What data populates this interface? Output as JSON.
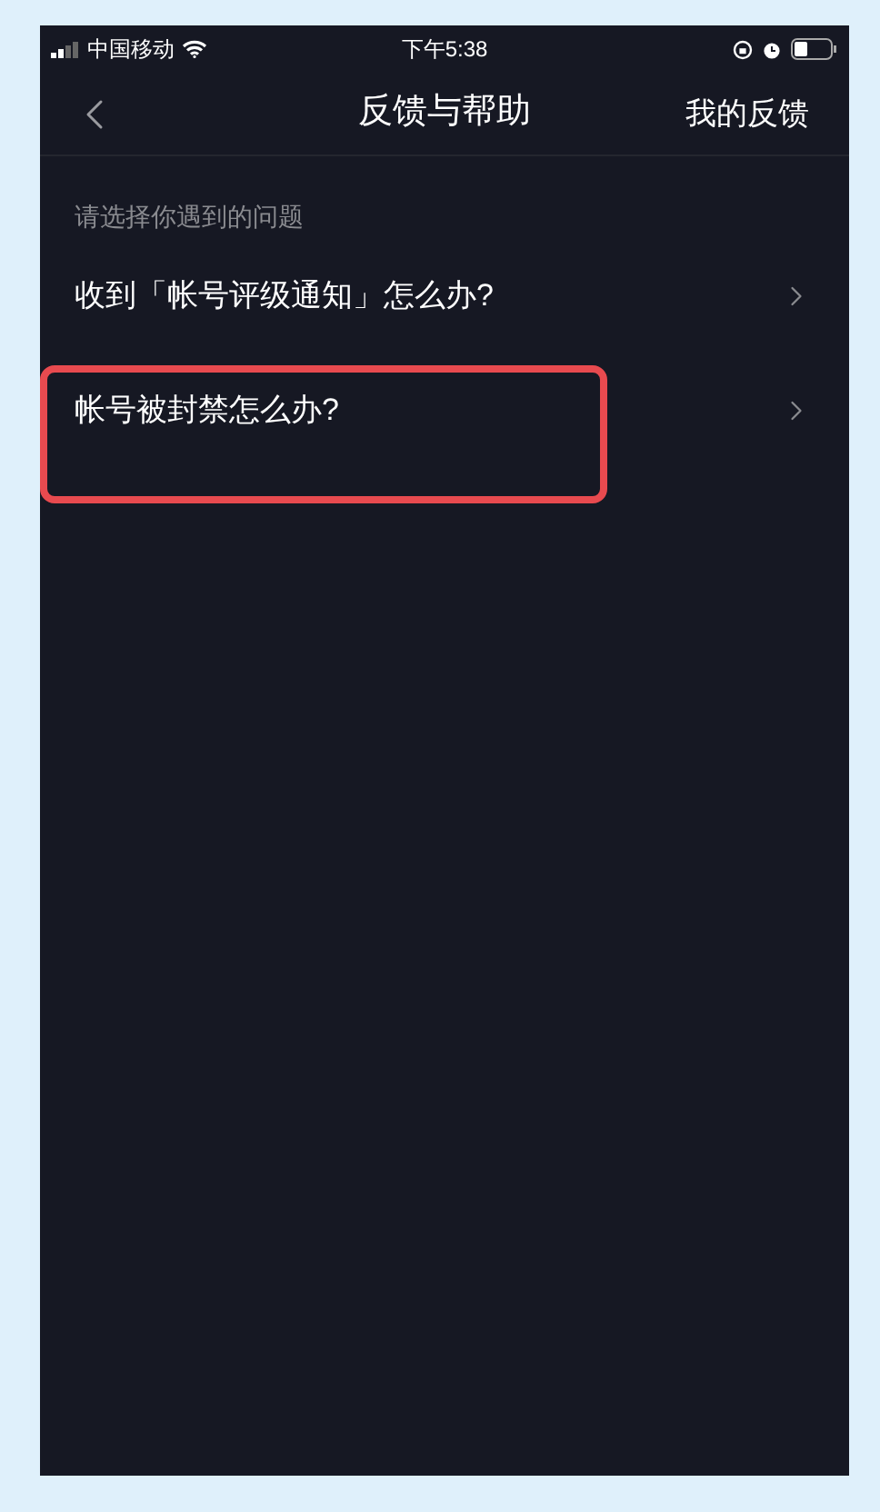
{
  "status_bar": {
    "carrier": "中国移动",
    "time": "下午5:38"
  },
  "nav": {
    "title": "反馈与帮助",
    "action": "我的反馈"
  },
  "hint": "请选择你遇到的问题",
  "items": [
    {
      "label": "收到「帐号评级通知」怎么办?",
      "highlighted": false
    },
    {
      "label": "帐号被封禁怎么办?",
      "highlighted": true
    }
  ]
}
